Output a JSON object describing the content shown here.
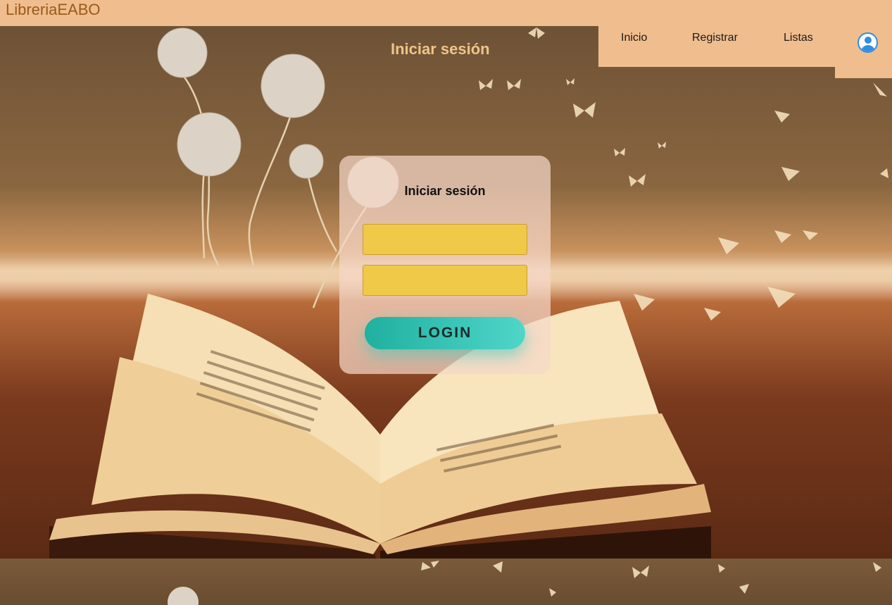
{
  "app": {
    "brand": "LibreriaEABO"
  },
  "nav": {
    "items": [
      {
        "label": "Inicio"
      },
      {
        "label": "Registrar"
      },
      {
        "label": "Listas"
      }
    ],
    "user_icon": "user-circle-icon"
  },
  "hero": {
    "title": "Iniciar sesión"
  },
  "login": {
    "title": "Iniciar sesión",
    "username_value": "",
    "password_value": "",
    "button_label": "LOGIN"
  },
  "colors": {
    "bar": "#f0bd8e",
    "brand_text": "#9a5a1a",
    "field": "#f0c948",
    "button_start": "#20b0a0",
    "button_end": "#4fd6c9"
  }
}
